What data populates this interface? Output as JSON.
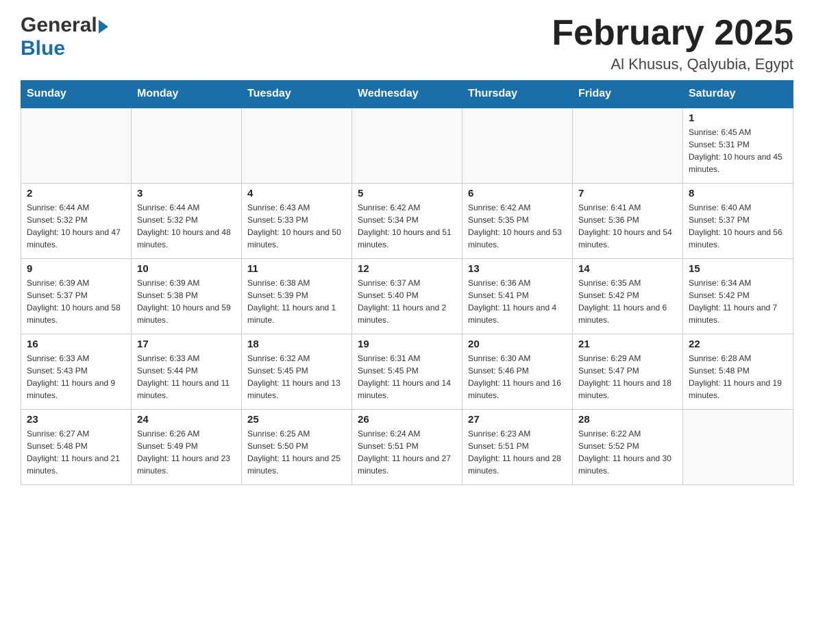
{
  "header": {
    "logo_general": "General",
    "logo_blue": "Blue",
    "title": "February 2025",
    "location": "Al Khusus, Qalyubia, Egypt"
  },
  "weekdays": [
    "Sunday",
    "Monday",
    "Tuesday",
    "Wednesday",
    "Thursday",
    "Friday",
    "Saturday"
  ],
  "weeks": [
    [
      {
        "day": "",
        "info": ""
      },
      {
        "day": "",
        "info": ""
      },
      {
        "day": "",
        "info": ""
      },
      {
        "day": "",
        "info": ""
      },
      {
        "day": "",
        "info": ""
      },
      {
        "day": "",
        "info": ""
      },
      {
        "day": "1",
        "info": "Sunrise: 6:45 AM\nSunset: 5:31 PM\nDaylight: 10 hours and 45 minutes."
      }
    ],
    [
      {
        "day": "2",
        "info": "Sunrise: 6:44 AM\nSunset: 5:32 PM\nDaylight: 10 hours and 47 minutes."
      },
      {
        "day": "3",
        "info": "Sunrise: 6:44 AM\nSunset: 5:32 PM\nDaylight: 10 hours and 48 minutes."
      },
      {
        "day": "4",
        "info": "Sunrise: 6:43 AM\nSunset: 5:33 PM\nDaylight: 10 hours and 50 minutes."
      },
      {
        "day": "5",
        "info": "Sunrise: 6:42 AM\nSunset: 5:34 PM\nDaylight: 10 hours and 51 minutes."
      },
      {
        "day": "6",
        "info": "Sunrise: 6:42 AM\nSunset: 5:35 PM\nDaylight: 10 hours and 53 minutes."
      },
      {
        "day": "7",
        "info": "Sunrise: 6:41 AM\nSunset: 5:36 PM\nDaylight: 10 hours and 54 minutes."
      },
      {
        "day": "8",
        "info": "Sunrise: 6:40 AM\nSunset: 5:37 PM\nDaylight: 10 hours and 56 minutes."
      }
    ],
    [
      {
        "day": "9",
        "info": "Sunrise: 6:39 AM\nSunset: 5:37 PM\nDaylight: 10 hours and 58 minutes."
      },
      {
        "day": "10",
        "info": "Sunrise: 6:39 AM\nSunset: 5:38 PM\nDaylight: 10 hours and 59 minutes."
      },
      {
        "day": "11",
        "info": "Sunrise: 6:38 AM\nSunset: 5:39 PM\nDaylight: 11 hours and 1 minute."
      },
      {
        "day": "12",
        "info": "Sunrise: 6:37 AM\nSunset: 5:40 PM\nDaylight: 11 hours and 2 minutes."
      },
      {
        "day": "13",
        "info": "Sunrise: 6:36 AM\nSunset: 5:41 PM\nDaylight: 11 hours and 4 minutes."
      },
      {
        "day": "14",
        "info": "Sunrise: 6:35 AM\nSunset: 5:42 PM\nDaylight: 11 hours and 6 minutes."
      },
      {
        "day": "15",
        "info": "Sunrise: 6:34 AM\nSunset: 5:42 PM\nDaylight: 11 hours and 7 minutes."
      }
    ],
    [
      {
        "day": "16",
        "info": "Sunrise: 6:33 AM\nSunset: 5:43 PM\nDaylight: 11 hours and 9 minutes."
      },
      {
        "day": "17",
        "info": "Sunrise: 6:33 AM\nSunset: 5:44 PM\nDaylight: 11 hours and 11 minutes."
      },
      {
        "day": "18",
        "info": "Sunrise: 6:32 AM\nSunset: 5:45 PM\nDaylight: 11 hours and 13 minutes."
      },
      {
        "day": "19",
        "info": "Sunrise: 6:31 AM\nSunset: 5:45 PM\nDaylight: 11 hours and 14 minutes."
      },
      {
        "day": "20",
        "info": "Sunrise: 6:30 AM\nSunset: 5:46 PM\nDaylight: 11 hours and 16 minutes."
      },
      {
        "day": "21",
        "info": "Sunrise: 6:29 AM\nSunset: 5:47 PM\nDaylight: 11 hours and 18 minutes."
      },
      {
        "day": "22",
        "info": "Sunrise: 6:28 AM\nSunset: 5:48 PM\nDaylight: 11 hours and 19 minutes."
      }
    ],
    [
      {
        "day": "23",
        "info": "Sunrise: 6:27 AM\nSunset: 5:48 PM\nDaylight: 11 hours and 21 minutes."
      },
      {
        "day": "24",
        "info": "Sunrise: 6:26 AM\nSunset: 5:49 PM\nDaylight: 11 hours and 23 minutes."
      },
      {
        "day": "25",
        "info": "Sunrise: 6:25 AM\nSunset: 5:50 PM\nDaylight: 11 hours and 25 minutes."
      },
      {
        "day": "26",
        "info": "Sunrise: 6:24 AM\nSunset: 5:51 PM\nDaylight: 11 hours and 27 minutes."
      },
      {
        "day": "27",
        "info": "Sunrise: 6:23 AM\nSunset: 5:51 PM\nDaylight: 11 hours and 28 minutes."
      },
      {
        "day": "28",
        "info": "Sunrise: 6:22 AM\nSunset: 5:52 PM\nDaylight: 11 hours and 30 minutes."
      },
      {
        "day": "",
        "info": ""
      }
    ]
  ]
}
